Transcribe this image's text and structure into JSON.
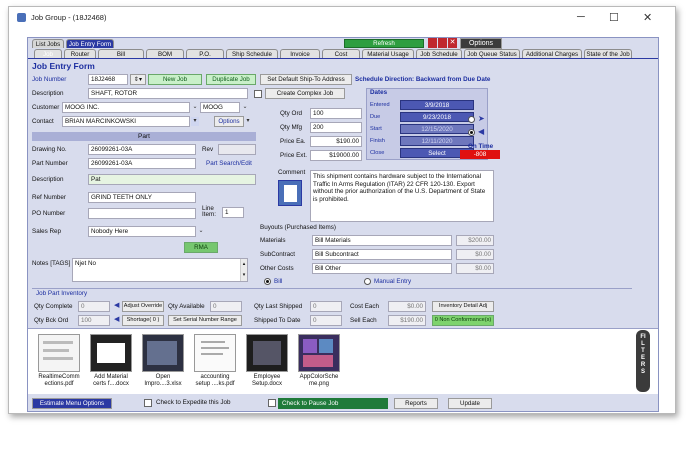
{
  "window": {
    "title": "Job Group - (18J2468)",
    "minimize": "─",
    "maximize": "☐",
    "close": "✕"
  },
  "tabs_top": {
    "list_jobs": "List Jobs",
    "job_entry_form": "Job Entry Form",
    "refresh": "Refresh",
    "options": "Options"
  },
  "tabs": [
    "Job",
    "Router",
    "Bill",
    "BOM",
    "P.O.",
    "Ship Schedule",
    "Invoice",
    "Cost",
    "Material Usage",
    "Job Schedule",
    "Job Queue Status",
    "Additional Charges",
    "State of the Job"
  ],
  "form": {
    "heading": "Job Entry Form",
    "job_number_label": "Job Number",
    "job_number": "18J2468",
    "new_job": "New Job",
    "duplicate_job": "Duplicate Job",
    "default_ship": "Set Default Ship-To Address",
    "ship_direction": "Schedule Direction: Backward from Due Date",
    "description_label": "Description",
    "description": "SHAFT, ROTOR",
    "complex_job": "Create Complex Job",
    "customer_label": "Customer",
    "customer": "MOOG INC.",
    "customer_code": "MOOG",
    "contact_label": "Contact",
    "contact": "BRIAN MARCINKOWSKI",
    "options_btn": "Options"
  },
  "part": {
    "header": "Part",
    "drawing_label": "Drawing No.",
    "drawing": "26099261-03A",
    "rev_label": "Rev",
    "rev": "",
    "part_number_label": "Part Number",
    "part_number": "26099261-03A",
    "part_search": "Part Search/Edit",
    "description_label": "Description",
    "description": "Pat"
  },
  "refs": {
    "ref_label": "Ref Number",
    "ref": "GRIND TEETH ONLY",
    "po_label": "PO Number",
    "po": "",
    "line_label": "Line Item:",
    "line": "1",
    "sales_label": "Sales Rep",
    "sales": "Nobody Here",
    "rma": "RMA",
    "notes_label": "Notes [TAGS]",
    "notes": "Njet No"
  },
  "quantities": {
    "qty_ord_label": "Qty Ord",
    "qty_ord": "100",
    "qty_mfg_label": "Qty Mfg",
    "qty_mfg": "200",
    "price_ea_label": "Price Ea.",
    "price_ea": "$190.00",
    "price_ext_label": "Price Ext.",
    "price_ext": "$19000.00"
  },
  "dates": {
    "header": "Dates",
    "entered_label": "Entered",
    "entered": "3/9/2018",
    "due_label": "Due",
    "due": "9/23/2018",
    "start_label": "Start",
    "start": "12/15/2020",
    "finish_label": "Finish",
    "finish": "12/11/2020",
    "close_label": "Close",
    "close": "Select",
    "on_time_label": "On Time",
    "on_time": "-808"
  },
  "comment": {
    "label": "Comment",
    "text": "This shipment contains hardware subject to the International Traffic In Arms Regulation (ITAR) 22 CFR 120-130. Export without the prior authorization of the U.S. Department of State is prohibited."
  },
  "buyouts": {
    "header": "Buyouts  (Purchased Items)",
    "materials_label": "Materials",
    "materials": "Bill Materials",
    "materials_amt": "$200.00",
    "subcontract_label": "SubContract",
    "subcontract": "Bill Subcontract",
    "subcontract_amt": "$0.00",
    "other_label": "Other Costs",
    "other": "Bill Other",
    "other_amt": "$0.00",
    "bill_radio": "Bill",
    "manual_radio": "Manual Entry"
  },
  "inventory": {
    "header": "Job Part Inventory",
    "qty_complete_label": "Qty Complete",
    "qty_complete": "0",
    "adjust_override": "Adjust Override",
    "qty_available_label": "Qty Available",
    "qty_available": "0",
    "qty_last_shipped_label": "Qty Last Shipped",
    "qty_last_shipped": "0",
    "cost_each_label": "Cost Each",
    "cost_each": "$0.00",
    "inventory_detail": "Inventory Detail Adj",
    "qty_bck_ord_label": "Qty Bck Ord",
    "qty_bck_ord": "100",
    "shortage": "Shortage( 0 )",
    "serial": "Set Serial Number Range",
    "shipped_to_date_label": "Shipped To Date",
    "shipped_to_date": "0",
    "sell_each_label": "Sell Each",
    "sell_each": "$190.00",
    "non_conformance": "0 Non Conformance(s)"
  },
  "attachments": [
    {
      "name": "RealtimeComm\nections.pdf"
    },
    {
      "name": "Add Material\ncerts f....docx"
    },
    {
      "name": "Open\nImpro....3.xlsx"
    },
    {
      "name": "accounting\nsetup ....ks.pdf"
    },
    {
      "name": "Employee\nSetup.docx"
    },
    {
      "name": "AppColorSche\nme.png"
    }
  ],
  "filters": "FILTERS",
  "footer": {
    "estimate_menu": "Estimate Menu Options",
    "expedite": "Check to Expedite this Job",
    "pause": "Check to Pause Job",
    "reports": "Reports",
    "update": "Update"
  },
  "colors": {
    "accent": "#2b39a3",
    "green_btn": "#c9f0c9",
    "date_box": "#4c58b3",
    "on_time": "#e01010"
  }
}
